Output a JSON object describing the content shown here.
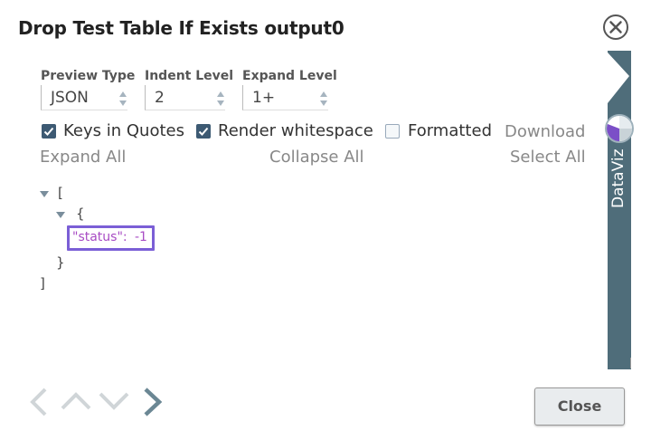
{
  "dialog": {
    "title": "Drop Test Table If Exists output0",
    "close_label": "Close"
  },
  "controls": {
    "preview_type": {
      "label": "Preview Type",
      "value": "JSON"
    },
    "indent_level": {
      "label": "Indent Level",
      "value": "2"
    },
    "expand_level": {
      "label": "Expand Level",
      "value": "1+"
    }
  },
  "options": {
    "keys_in_quotes": {
      "label": "Keys in Quotes",
      "checked": true
    },
    "render_whitespace": {
      "label": "Render whitespace",
      "checked": true
    },
    "formatted": {
      "label": "Formatted",
      "checked": false
    },
    "download": "Download",
    "expand_all": "Expand All",
    "collapse_all": "Collapse All",
    "select_all": "Select All"
  },
  "preview": {
    "open_bracket": "[",
    "open_brace": "{",
    "key": "\"status\":",
    "value": "-1",
    "close_brace": "}",
    "close_bracket": "]"
  },
  "sidebar": {
    "label": "DataViz"
  },
  "colors": {
    "sidebar": "#4f6d7a",
    "highlight": "#7b5fd6",
    "key_color": "#a84cc4",
    "checkbox": "#3d5a73"
  },
  "icons": [
    "close-circle-icon",
    "chevron-left-icon",
    "chevron-up-icon",
    "chevron-down-icon",
    "chevron-right-icon",
    "pie-chart-icon"
  ]
}
